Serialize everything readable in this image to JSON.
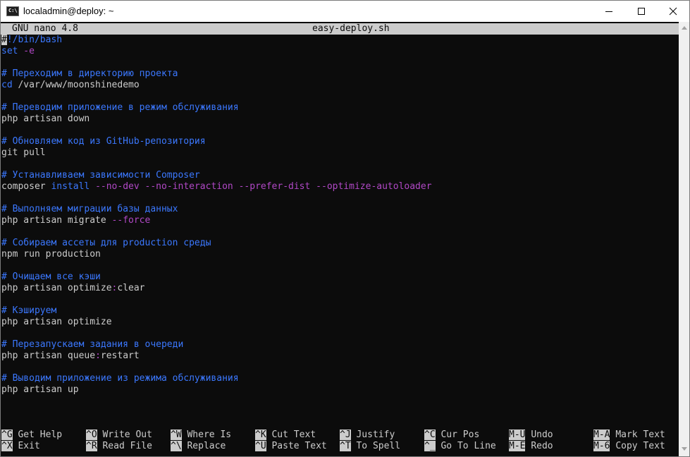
{
  "window": {
    "title": "localadmin@deploy: ~",
    "icon_label": "C:\\"
  },
  "nano": {
    "version": "GNU nano 4.8",
    "filename": "easy-deploy.sh"
  },
  "code": {
    "l1a": "#",
    "l1b": "!/bin/bash",
    "l2a": "set",
    "l2b": " -e",
    "l3": "",
    "l4": "# Переходим в директорию проекта",
    "l5a": "cd",
    "l5b": " /var/www/moonshinedemo",
    "l6": "",
    "l7": "# Переводим приложение в режим обслуживания",
    "l8": "php artisan down",
    "l9": "",
    "l10": "# Обновляем код из GitHub-репозитория",
    "l11": "git pull",
    "l12": "",
    "l13": "# Устанавливаем зависимости Composer",
    "l14a": "composer ",
    "l14b": "install",
    "l14c": " ",
    "l14d": "--no-dev",
    "l14e": " ",
    "l14f": "--no-interaction",
    "l14g": " ",
    "l14h": "--prefer-dist",
    "l14i": " ",
    "l14j": "--optimize-autoloader",
    "l15": "",
    "l16": "# Выполняем миграции базы данных",
    "l17a": "php artisan migrate ",
    "l17b": "--force",
    "l18": "",
    "l19": "# Собираем ассеты для production среды",
    "l20": "npm run production",
    "l21": "",
    "l22": "# Очищаем все кэши",
    "l23a": "php artisan optimize",
    "l23b": ":",
    "l23c": "clear",
    "l24": "",
    "l25": "# Кэшируем",
    "l26": "php artisan optimize",
    "l27": "",
    "l28": "# Перезапускаем задания в очереди",
    "l29a": "php artisan queue",
    "l29b": ":",
    "l29c": "restart",
    "l30": "",
    "l31": "# Выводим приложение из режима обслуживания",
    "l32": "php artisan up"
  },
  "shortcuts": [
    {
      "key": "^G",
      "label": "Get Help"
    },
    {
      "key": "^O",
      "label": "Write Out"
    },
    {
      "key": "^W",
      "label": "Where Is"
    },
    {
      "key": "^K",
      "label": "Cut Text"
    },
    {
      "key": "^J",
      "label": "Justify"
    },
    {
      "key": "^C",
      "label": "Cur Pos"
    },
    {
      "key": "M-U",
      "label": "Undo"
    },
    {
      "key": "M-A",
      "label": "Mark Text"
    },
    {
      "key": "^X",
      "label": "Exit"
    },
    {
      "key": "^R",
      "label": "Read File"
    },
    {
      "key": "^\\",
      "label": "Replace"
    },
    {
      "key": "^U",
      "label": "Paste Text"
    },
    {
      "key": "^T",
      "label": "To Spell"
    },
    {
      "key": "^_",
      "label": "Go To Line"
    },
    {
      "key": "M-E",
      "label": "Redo"
    },
    {
      "key": "M-6",
      "label": "Copy Text"
    }
  ],
  "colors": {
    "background": "#0c0c0c",
    "text": "#cccccc",
    "comment": "#3b78ff",
    "flag": "#b148c6",
    "status_bar": "#cccccc"
  }
}
